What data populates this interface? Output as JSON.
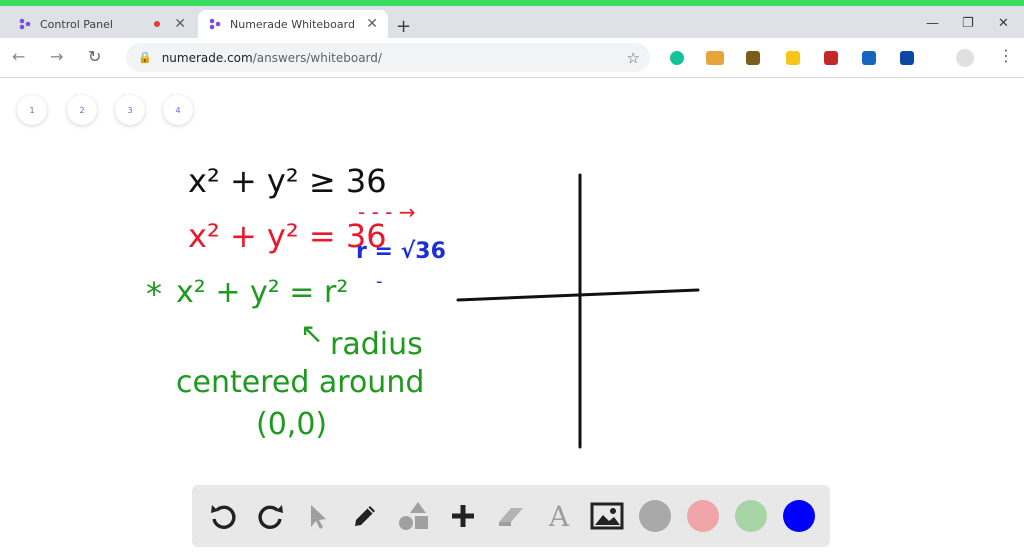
{
  "browser": {
    "tabs": [
      {
        "title": "Control Panel"
      },
      {
        "title": "Numerade Whiteboard"
      }
    ],
    "url_host": "numerade.com",
    "url_path": "/answers/whiteboard/"
  },
  "pages": [
    "1",
    "2",
    "3",
    "4"
  ],
  "whiteboard": {
    "line1": "x² + y² ≥ 36",
    "line2": "x² + y² = 36",
    "line2_arrow": "- - - →",
    "radius_note": "r = √36",
    "radius_dash": "-",
    "line3_star": "*",
    "line3": "x² + y² = r²",
    "arrow_up": "↖",
    "radius_label": "radius",
    "centered_label": "centered around",
    "origin_label": "(0,0)"
  },
  "colors": {
    "ink_black": "#111111",
    "ink_red": "#e8192c",
    "ink_blue": "#1a2fd4",
    "ink_green": "#1e9a1e",
    "swatch_gray": "#a9a9a9",
    "swatch_pink": "#f0a5a8",
    "swatch_green": "#a7d5a5",
    "swatch_blue": "#0000ff"
  },
  "tools": [
    "undo-icon",
    "redo-icon",
    "pointer-icon",
    "pencil-icon",
    "shapes-icon",
    "plus-icon",
    "eraser-icon",
    "text-icon",
    "image-icon"
  ]
}
